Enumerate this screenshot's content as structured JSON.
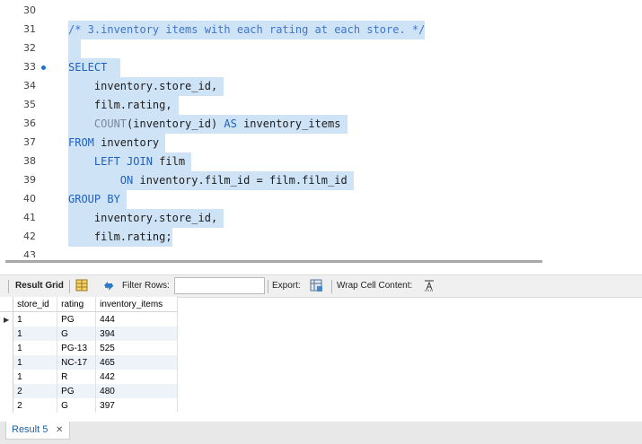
{
  "editor": {
    "lines": [
      {
        "n": "30",
        "segs": []
      },
      {
        "n": "31",
        "segs": [
          {
            "t": "/* 3.inventory items with each rating at each store. */",
            "c": "cm"
          }
        ]
      },
      {
        "n": "32",
        "segs": [
          {
            "t": "  ",
            "c": ""
          }
        ]
      },
      {
        "n": "33",
        "bullet": true,
        "segs": [
          {
            "t": "SELECT  ",
            "c": "kw"
          }
        ]
      },
      {
        "n": "34",
        "segs": [
          {
            "t": "    inventory.store_id, ",
            "c": ""
          }
        ]
      },
      {
        "n": "35",
        "segs": [
          {
            "t": "    film.rating, ",
            "c": ""
          }
        ]
      },
      {
        "n": "36",
        "segs": [
          {
            "t": "    ",
            "c": ""
          },
          {
            "t": "COUNT",
            "c": "fn"
          },
          {
            "t": "(inventory_id) ",
            "c": ""
          },
          {
            "t": "AS",
            "c": "kw"
          },
          {
            "t": " inventory_items ",
            "c": ""
          }
        ]
      },
      {
        "n": "37",
        "segs": [
          {
            "t": "FROM",
            "c": "kw"
          },
          {
            "t": " inventory ",
            "c": ""
          }
        ]
      },
      {
        "n": "38",
        "segs": [
          {
            "t": "    ",
            "c": ""
          },
          {
            "t": "LEFT JOIN",
            "c": "kw"
          },
          {
            "t": " film ",
            "c": ""
          }
        ]
      },
      {
        "n": "39",
        "segs": [
          {
            "t": "        ",
            "c": ""
          },
          {
            "t": "ON",
            "c": "kw"
          },
          {
            "t": " inventory.film_id = film.film_id ",
            "c": ""
          }
        ]
      },
      {
        "n": "40",
        "segs": [
          {
            "t": "GROUP BY ",
            "c": "kw"
          }
        ]
      },
      {
        "n": "41",
        "segs": [
          {
            "t": "    inventory.store_id, ",
            "c": ""
          }
        ]
      },
      {
        "n": "42",
        "segs": [
          {
            "t": "    film.rating;",
            "c": ""
          }
        ]
      }
    ],
    "next_line_partial": "43"
  },
  "toolbar": {
    "result_grid_label": "Result Grid",
    "filter_rows_label": "Filter Rows:",
    "filter_value": "",
    "export_label": "Export:",
    "wrap_label": "Wrap Cell Content:"
  },
  "grid": {
    "columns": [
      "store_id",
      "rating",
      "inventory_items"
    ],
    "rows": [
      [
        "1",
        "PG",
        "444"
      ],
      [
        "1",
        "G",
        "394"
      ],
      [
        "1",
        "PG-13",
        "525"
      ],
      [
        "1",
        "NC-17",
        "465"
      ],
      [
        "1",
        "R",
        "442"
      ],
      [
        "2",
        "PG",
        "480"
      ],
      [
        "2",
        "G",
        "397"
      ]
    ],
    "selected_marker": "▶"
  },
  "result_tab": {
    "label": "Result 5",
    "close": "✕"
  },
  "colors": {
    "selection": "#cfe3f7",
    "keyword": "#1f5fbf"
  }
}
